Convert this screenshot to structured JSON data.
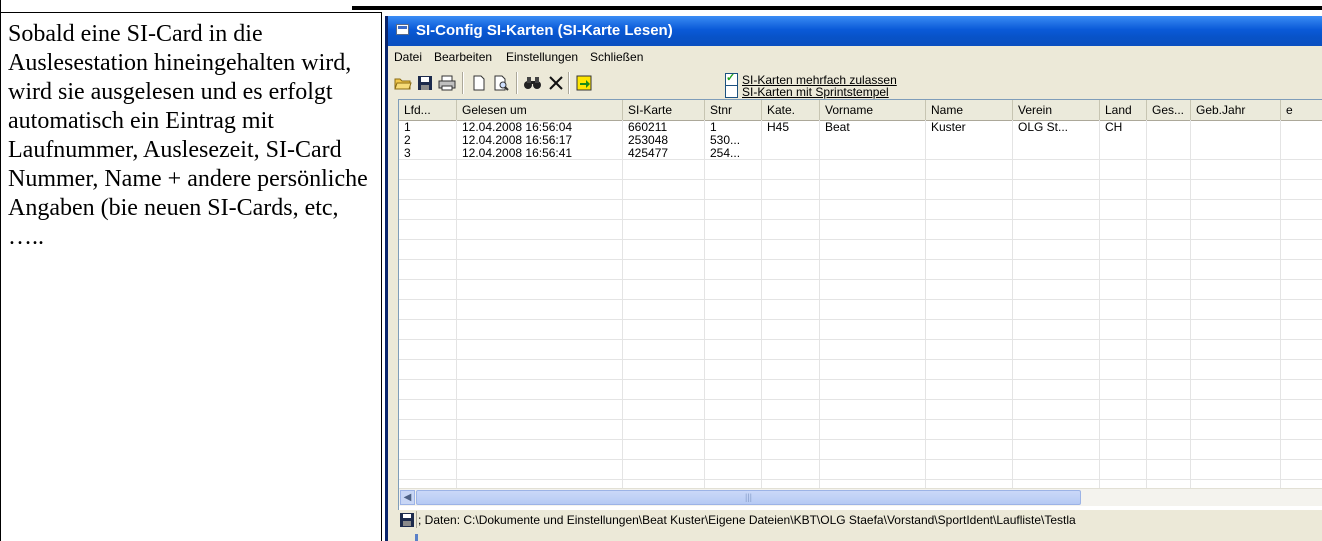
{
  "document": {
    "paragraph": "Sobald eine SI-Card in die Auslesestation hineingehalten wird, wird sie ausgelesen und es erfolgt automatisch ein Eintrag mit Laufnummer, Auslesezeit, SI-Card Nummer, Name + andere persönliche Angaben (bie neuen SI-Cards, etc, ….."
  },
  "window": {
    "title": "SI-Config SI-Karten (SI-Karte Lesen)"
  },
  "menu": [
    "Datei",
    "Bearbeiten",
    "Einstellungen",
    "Schließen"
  ],
  "toolbar": {
    "icons": [
      "open-folder-icon",
      "save-icon",
      "print-icon",
      "new-document-icon",
      "print-preview-icon",
      "binoculars-icon",
      "delete-icon",
      "export-icon"
    ],
    "options": [
      {
        "label": "SI-Karten mehrfach zulassen",
        "checked": true
      },
      {
        "label": "SI-Karten mit Sprintstempel",
        "checked": false
      }
    ]
  },
  "table": {
    "columns": [
      "Lfd...",
      "Gelesen um",
      "SI-Karte",
      "Stnr",
      "Kate.",
      "Vorname",
      "Name",
      "Verein",
      "Land",
      "Ges...",
      "Geb.Jahr",
      "e"
    ],
    "rows": [
      [
        "1",
        "12.04.2008 16:56:04",
        "660211",
        "1",
        "H45",
        "Beat",
        "Kuster",
        "OLG St...",
        "CH",
        "",
        "",
        ""
      ],
      [
        "2",
        "12.04.2008 16:56:17",
        "253048",
        "530...",
        "",
        "",
        "",
        "",
        "",
        "",
        "",
        ""
      ],
      [
        "3",
        "12.04.2008 16:56:41",
        "425477",
        "254...",
        "",
        "",
        "",
        "",
        "",
        "",
        "",
        ""
      ]
    ]
  },
  "status": {
    "text": "; Daten: C:\\Dokumente und Einstellungen\\Beat Kuster\\Eigene Dateien\\KBT\\OLG Staefa\\Vorstand\\SportIdent\\Laufliste\\Testla"
  },
  "colors": {
    "title_bar": "#0a5ad8",
    "window_bg": "#ece9d8",
    "check_mark": "#21a121"
  }
}
